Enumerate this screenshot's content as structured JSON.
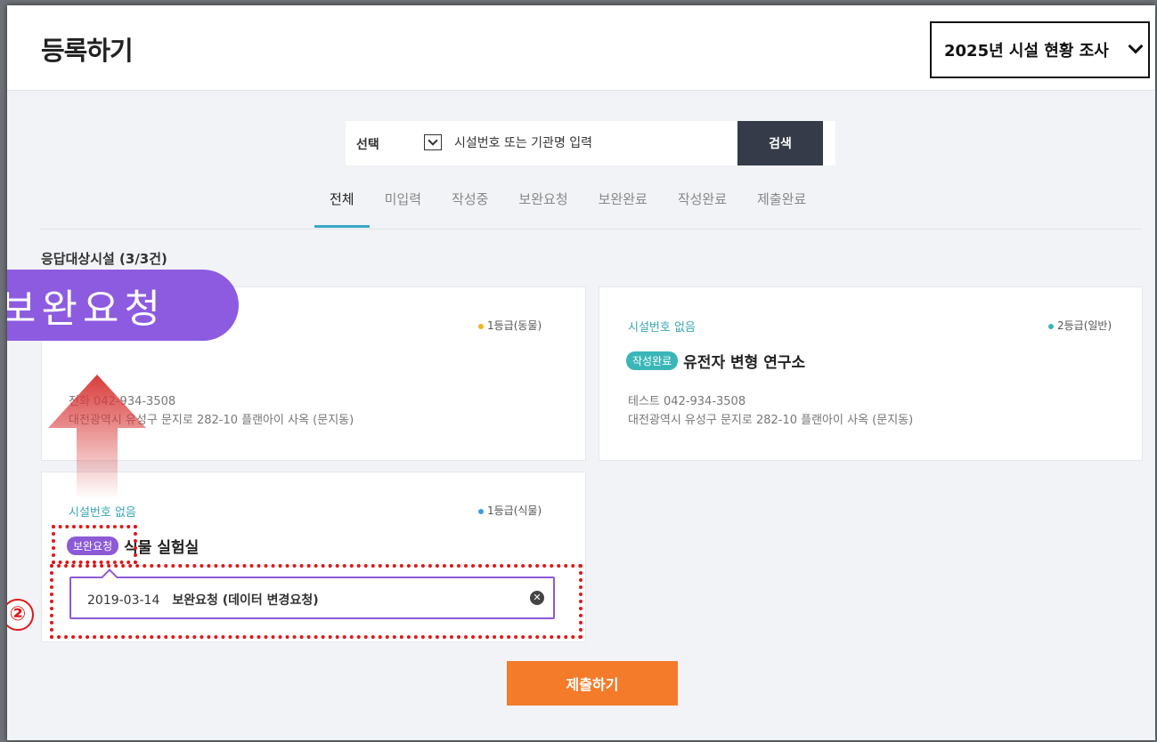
{
  "page": {
    "title": "등록하기",
    "survey_select_value": "2025년 시설 현황 조사"
  },
  "search": {
    "select_value": "선택",
    "placeholder": "시설번호 또는 기관명 입력",
    "button_label": "검색"
  },
  "tabs": [
    {
      "label": "전체",
      "active": true
    },
    {
      "label": "미입력",
      "active": false
    },
    {
      "label": "작성중",
      "active": false
    },
    {
      "label": "보완요청",
      "active": false
    },
    {
      "label": "보완완료",
      "active": false
    },
    {
      "label": "작성완료",
      "active": false
    },
    {
      "label": "제출완료",
      "active": false
    }
  ],
  "count_label": "응답대상시설 (3/3건)",
  "cards": [
    {
      "grade": "1등급(동물)",
      "grade_color": "#f0b41c",
      "contact": "전화 042-934-3508",
      "address": "대전광역시 유성구 문지로 282-10 플랜아이 사옥 (문지동)"
    },
    {
      "facility_no": "시설번호 없음",
      "grade": "2등급(일반)",
      "grade_color": "#3ab6b8",
      "status_badge": "작성완료",
      "status_color": "#3ab6b8",
      "name": "유전자 변형 연구소",
      "contact": "테스트 042-934-3508",
      "address": "대전광역시 유성구 문지로 282-10 플랜아이 사옥 (문지동)"
    },
    {
      "facility_no": "시설번호 없음",
      "grade": "1등급(식물)",
      "grade_color": "#3a9fd8",
      "status_badge": "보완요청",
      "status_color": "#8c5ad6",
      "name": "식물 실험실",
      "request": {
        "date": "2019-03-14",
        "text": "보완요청 (데이터 변경요청)"
      }
    }
  ],
  "submit_label": "제출하기",
  "annotation": {
    "callout_text": "보완요청",
    "step_number": "②",
    "accent_color": "#8d5be0",
    "highlight_color": "#e01818"
  }
}
